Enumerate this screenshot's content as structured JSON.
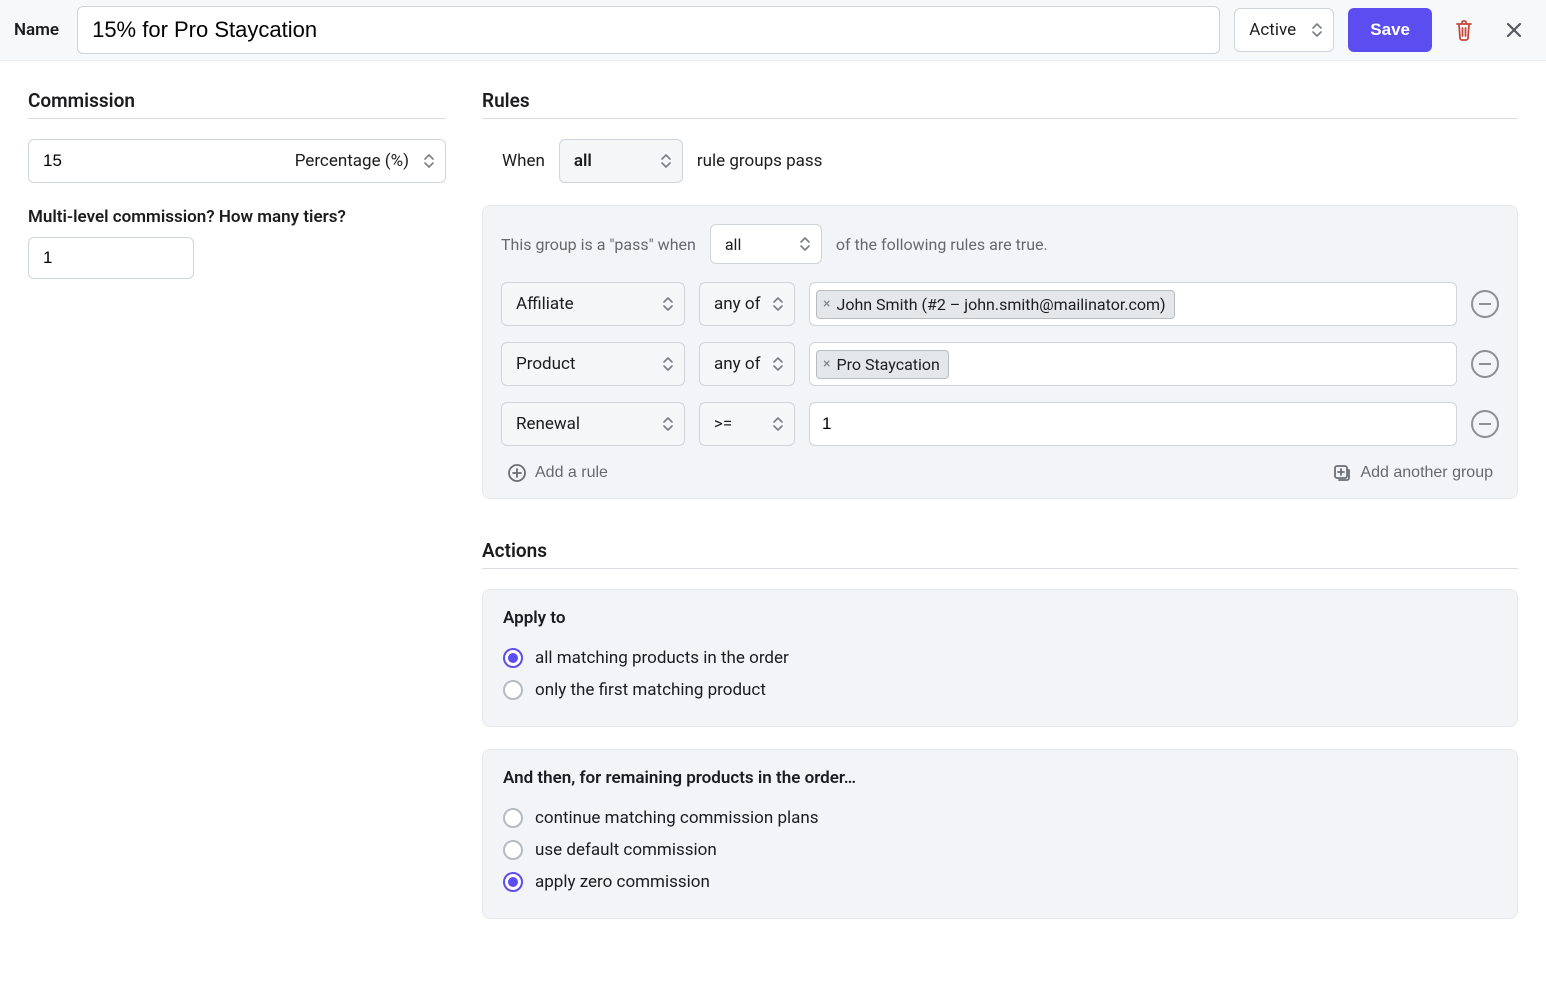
{
  "header": {
    "name_label": "Name",
    "name_value": "15% for Pro Staycation",
    "status": "Active",
    "save_label": "Save"
  },
  "commission": {
    "title": "Commission",
    "value": "15",
    "type_label": "Percentage (%)",
    "tiers_label": "Multi-level commission? How many tiers?",
    "tiers_value": "1"
  },
  "rules": {
    "title": "Rules",
    "when_prefix": "When",
    "when_mode": "all",
    "when_suffix": "rule groups pass",
    "group": {
      "prefix": "This group is a \"pass\" when",
      "mode": "all",
      "suffix": "of the following rules are true.",
      "rows": [
        {
          "field": "Affiliate",
          "op": "any of",
          "chips": [
            "John Smith (#2 – john.smith@mailinator.com)"
          ]
        },
        {
          "field": "Product",
          "op": "any of",
          "chips": [
            "Pro Staycation"
          ]
        },
        {
          "field": "Renewal",
          "op": ">=",
          "value": "1"
        }
      ],
      "add_rule_label": "Add a rule",
      "add_group_label": "Add another group"
    }
  },
  "actions": {
    "title": "Actions",
    "apply_to": {
      "heading": "Apply to",
      "options": [
        {
          "label": "all matching products in the order",
          "checked": true
        },
        {
          "label": "only the first matching product",
          "checked": false
        }
      ]
    },
    "remaining": {
      "heading": "And then, for remaining products in the order…",
      "options": [
        {
          "label": "continue matching commission plans",
          "checked": false
        },
        {
          "label": "use default commission",
          "checked": false
        },
        {
          "label": "apply zero commission",
          "checked": true
        }
      ]
    }
  }
}
